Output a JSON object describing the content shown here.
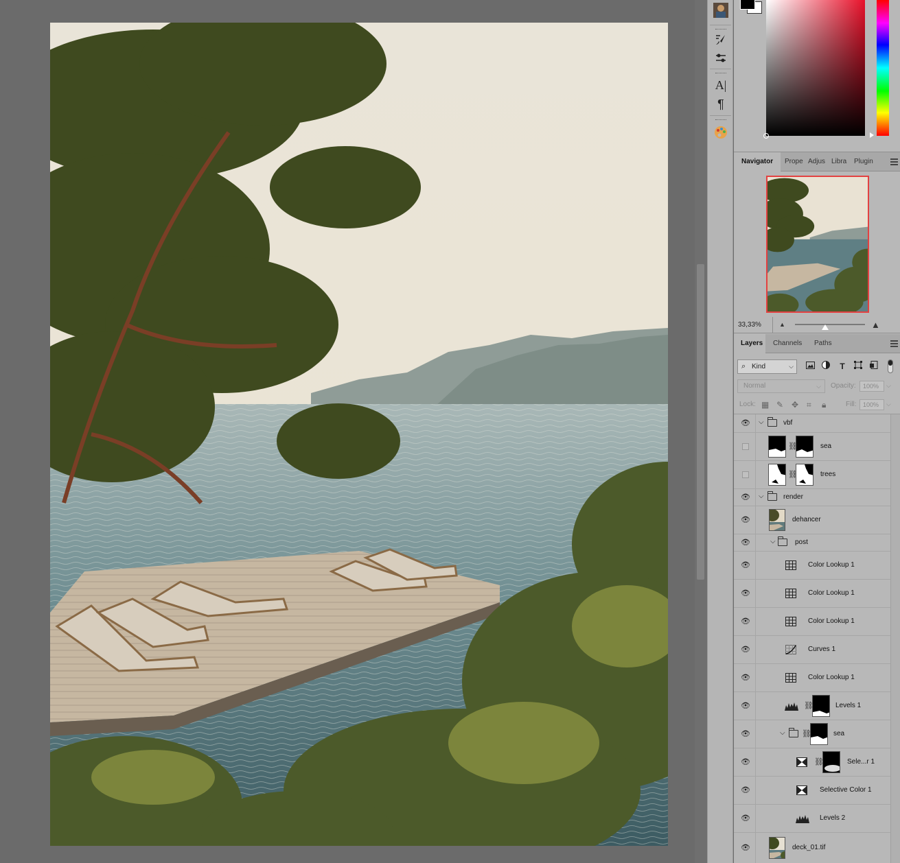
{
  "panels": {
    "top_tabs": [
      "Navigator",
      "Prope",
      "Adjus",
      "Libra",
      "Plugin"
    ],
    "navigator": {
      "zoom": "33,33%"
    },
    "layer_tabs": [
      "Layers",
      "Channels",
      "Paths"
    ],
    "filter": {
      "kind": "Kind"
    },
    "blend": {
      "mode": "Normal",
      "opacity_label": "Opacity:",
      "opacity": "100%",
      "lock_label": "Lock:",
      "fill_label": "Fill:",
      "fill": "100%"
    },
    "layers": [
      {
        "name": "vbf",
        "type": "group"
      },
      {
        "name": "sea",
        "type": "masked"
      },
      {
        "name": "trees",
        "type": "masked"
      },
      {
        "name": "render",
        "type": "group"
      },
      {
        "name": "dehancer",
        "type": "image"
      },
      {
        "name": "post",
        "type": "group"
      },
      {
        "name": "Color Lookup 1",
        "type": "lookup"
      },
      {
        "name": "Color Lookup 1",
        "type": "lookup"
      },
      {
        "name": "Color Lookup 1",
        "type": "lookup"
      },
      {
        "name": "Curves 1",
        "type": "curves"
      },
      {
        "name": "Color Lookup 1",
        "type": "lookup"
      },
      {
        "name": "Levels 1",
        "type": "levels-mask"
      },
      {
        "name": "sea",
        "type": "group-mask"
      },
      {
        "name": "Sele...r 1",
        "type": "selective-mask"
      },
      {
        "name": "Selective Color 1",
        "type": "selective"
      },
      {
        "name": "Levels 2",
        "type": "levels"
      },
      {
        "name": "deck_01.tif",
        "type": "image"
      }
    ]
  },
  "icons": {
    "tools": [
      "portrait-icon",
      "brush-settings-icon",
      "clone-source-icon",
      "character-icon",
      "paragraph-icon",
      "color-palette-icon"
    ]
  }
}
